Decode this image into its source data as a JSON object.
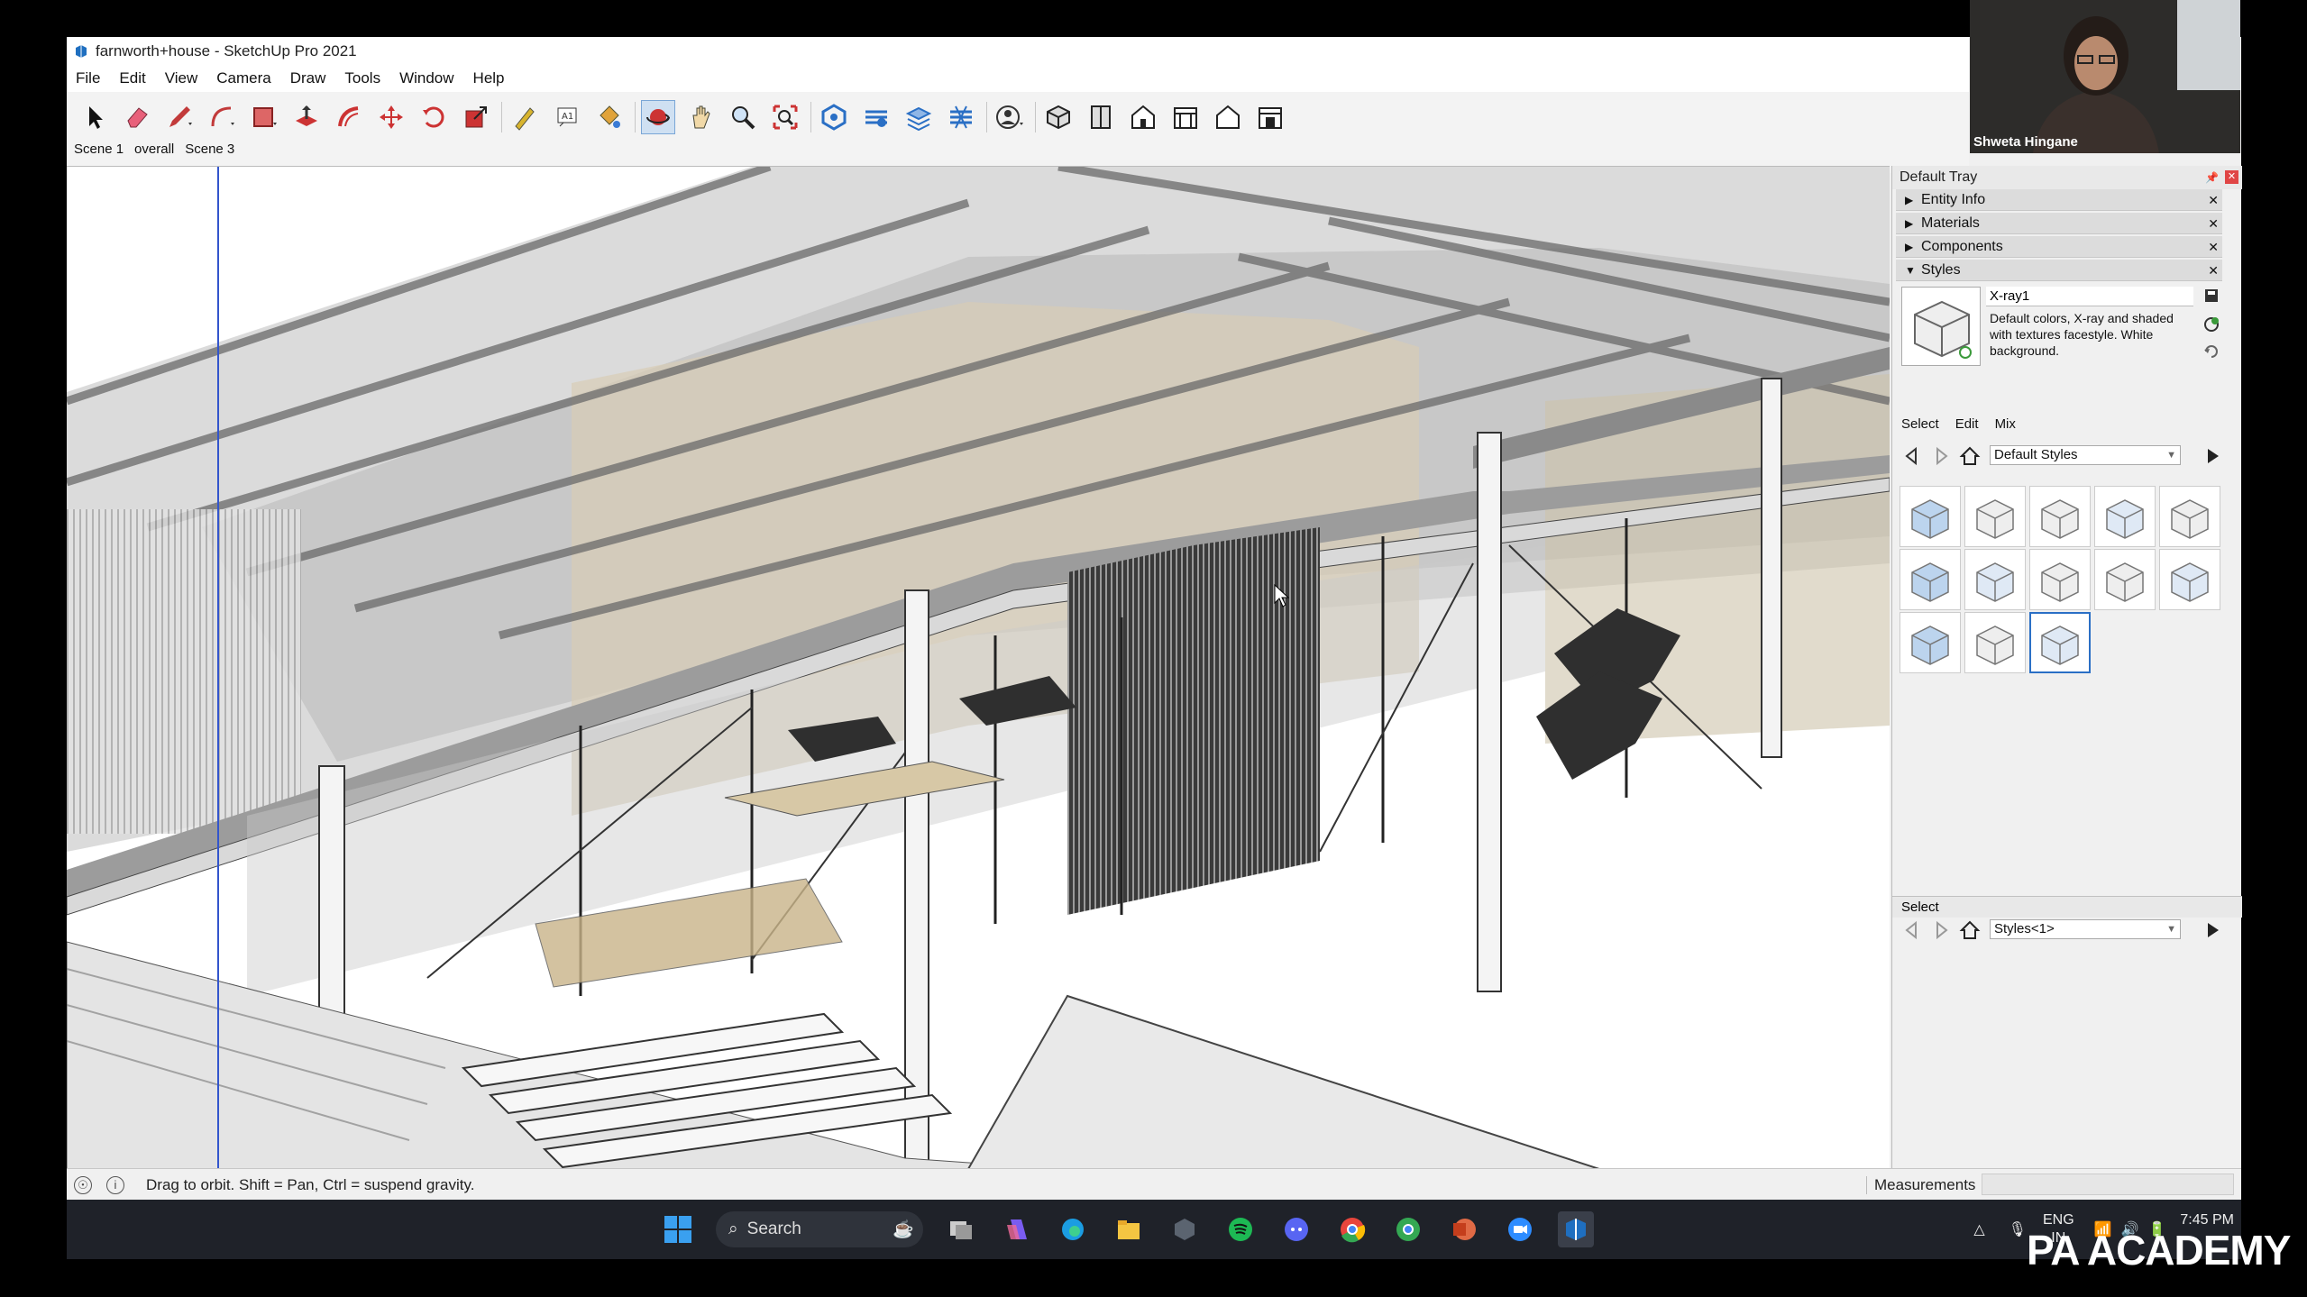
{
  "window": {
    "title": "farnworth+house - SketchUp Pro 2021"
  },
  "menu": [
    "File",
    "Edit",
    "View",
    "Camera",
    "Draw",
    "Tools",
    "Window",
    "Help"
  ],
  "scenes": [
    "Scene 1",
    "overall",
    "Scene 3"
  ],
  "tray": {
    "title": "Default Tray",
    "panels": [
      {
        "label": "Entity Info",
        "expanded": false
      },
      {
        "label": "Materials",
        "expanded": false
      },
      {
        "label": "Components",
        "expanded": false
      },
      {
        "label": "Styles",
        "expanded": true
      }
    ],
    "style": {
      "name": "X-ray1",
      "description": "Default colors, X-ray and shaded with textures facestyle. White background."
    },
    "tabs": [
      "Select",
      "Edit",
      "Mix"
    ],
    "collection": "Default Styles",
    "lower_select_label": "Select",
    "lower_collection": "Styles<1>"
  },
  "status": {
    "message": "Drag to orbit. Shift = Pan, Ctrl = suspend gravity.",
    "measurements_label": "Measurements"
  },
  "webcam": {
    "name": "Shweta Hingane"
  },
  "taskbar": {
    "search_placeholder": "Search",
    "lang_line1": "ENG",
    "lang_line2": "IN",
    "time": "7:45 PM"
  },
  "watermark": "PA ACADEMY"
}
